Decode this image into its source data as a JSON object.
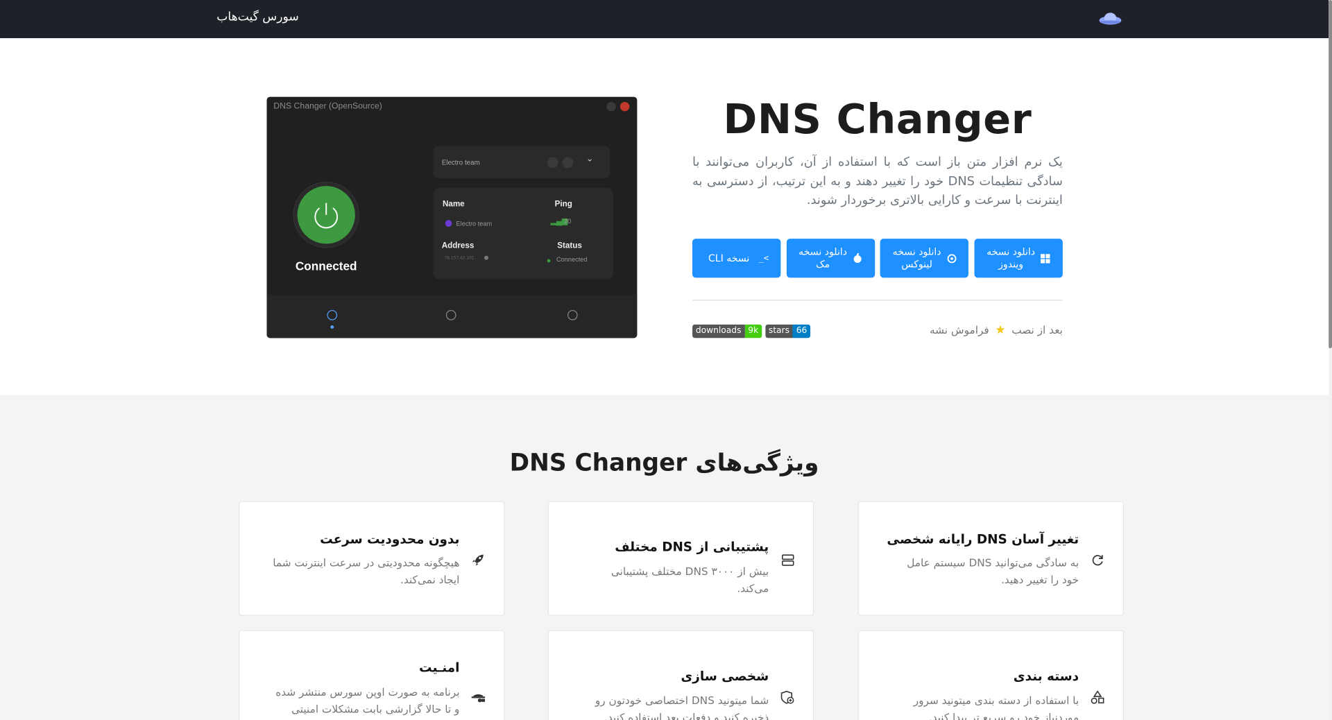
{
  "navbar": {
    "source_link": "سورس گیت‌هاب",
    "logo_icon": "cloud-logo-icon"
  },
  "hero": {
    "title": "DNS Changer",
    "description": "یک نرم افزار متن باز است که با استفاده از آن، کاربران می‌توانند با سادگی تنظیمات DNS خود را تغییر دهند و به این ترتیب، از دسترسی به اینترنت با سرعت و کارایی بالاتری برخوردار شوند.",
    "buttons": [
      {
        "label": "دانلود نسخه ویندوز",
        "icon": "windows-icon"
      },
      {
        "label": "دانلود نسخه لینوکس",
        "icon": "linux-icon"
      },
      {
        "label": "دانلود نسخه مک",
        "icon": "apple-icon"
      },
      {
        "label": "نسخه CLI",
        "icon": "terminal-icon"
      }
    ],
    "after_install": {
      "before": "بعد از نصب",
      "after": "فراموش نشه"
    },
    "badges": [
      {
        "key": "downloads",
        "value": "9k",
        "color": "#4c1"
      },
      {
        "key": "stars",
        "value": "66",
        "color": "#007ec6"
      }
    ]
  },
  "app": {
    "window_title": "DNS Changer (OpenSource)",
    "selector": "Electro team",
    "status_big": "Connected",
    "name_label": "Name",
    "name_value": "Electro team",
    "ping_label": "Ping",
    "ping_value": "20",
    "address_label": "Address",
    "address_value": "78.157.42.101...",
    "status_label": "Status",
    "status_value": "Connected"
  },
  "features": {
    "title": "ویژگی‌های DNS Changer",
    "items": [
      {
        "title": "تغییر آسان DNS رایانه شخصی",
        "desc": "به سادگی می‌توانید DNS سیستم عامل خود را تغییر دهید.",
        "icon": "refresh-icon"
      },
      {
        "title": "پشتیبانی از DNS مختلف",
        "desc": "بیش از ۳۰۰۰ DNS مختلف پشتیبانی می‌کند.",
        "icon": "server-icon"
      },
      {
        "title": "بدون محدودیت سرعت",
        "desc": "هیچگونه محدودیتی در سرعت اینترنت شما ایجاد نمی‌کند.",
        "icon": "rocket-icon"
      },
      {
        "title": "دسته بندی",
        "desc": "با استفاده از دسته بندی میتونید سرور موردنیاز خود رو سریع تر پیدا کنید.",
        "icon": "shapes-icon"
      },
      {
        "title": "شخصی سازی",
        "desc": "شما میتونید DNS اختصاصی خودتون رو ذخیره کنید و دفعات بعد استفاده کنید.",
        "icon": "shield-plus-icon"
      },
      {
        "title": "امنـیت",
        "desc": "برنامه به صورت اوپن سورس منتشر شده و تا حالا گزارشی بابت مشکلات امنیتی دریافت",
        "icon": "spy-icon"
      }
    ]
  }
}
